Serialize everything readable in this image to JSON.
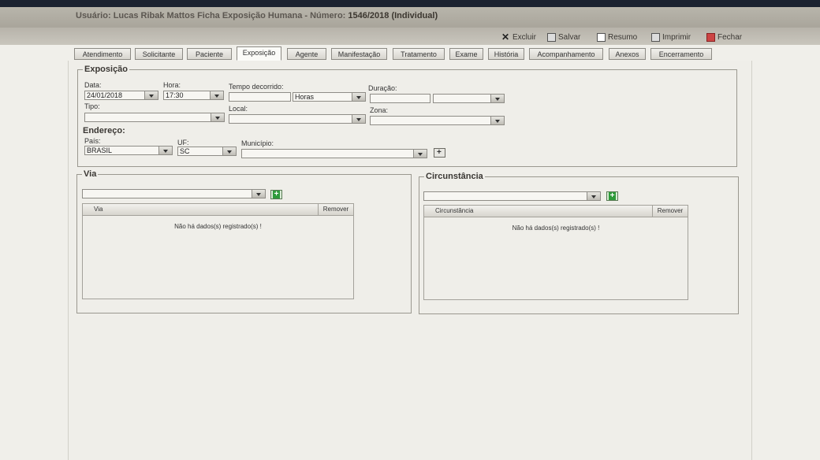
{
  "window": {
    "user_label": "Usuário:",
    "user_name": "Lucas Ribak Mattos",
    "form_title": "Ficha Exposição Humana - Número:",
    "record_number": "1546/2018 (Individual)"
  },
  "toolbar": {
    "excluir": "Excluir",
    "salvar": "Salvar",
    "resumo": "Resumo",
    "imprimir": "Imprimir",
    "fechar": "Fechar"
  },
  "tabs": [
    "Atendimento",
    "Solicitante",
    "Paciente",
    "Exposição",
    "Agente",
    "Manifestação",
    "Tratamento",
    "Exame",
    "História",
    "Acompanhamento",
    "Anexos",
    "Encerramento"
  ],
  "active_tab": "Exposição",
  "exposicao": {
    "legend": "Exposição",
    "data_label": "Data:",
    "data_value": "24/01/2018",
    "hora_label": "Hora:",
    "hora_value": "17:30",
    "tempo_label": "Tempo decorrido:",
    "tempo_value": "",
    "tempo_unit": "Horas",
    "duracao_label": "Duração:",
    "duracao_value": "",
    "duracao_unit": "",
    "tipo_label": "Tipo:",
    "tipo_value": "",
    "local_label": "Local:",
    "local_value": "",
    "zona_label": "Zona:",
    "zona_value": "",
    "endereco_label": "Endereço:",
    "pais_label": "País:",
    "pais_value": "BRASIL",
    "uf_label": "UF:",
    "uf_value": "SC",
    "municipio_label": "Município:",
    "municipio_value": ""
  },
  "via": {
    "legend": "Via",
    "select_value": "",
    "col_via": "Via",
    "col_remover": "Remover",
    "empty_message": "Não há dados(s) registrado(s) !"
  },
  "circunstancia": {
    "legend": "Circunstância",
    "select_value": "",
    "col_circunstancia": "Circunstância",
    "col_remover": "Remover",
    "empty_message": "Não há dados(s) registrado(s) !"
  }
}
